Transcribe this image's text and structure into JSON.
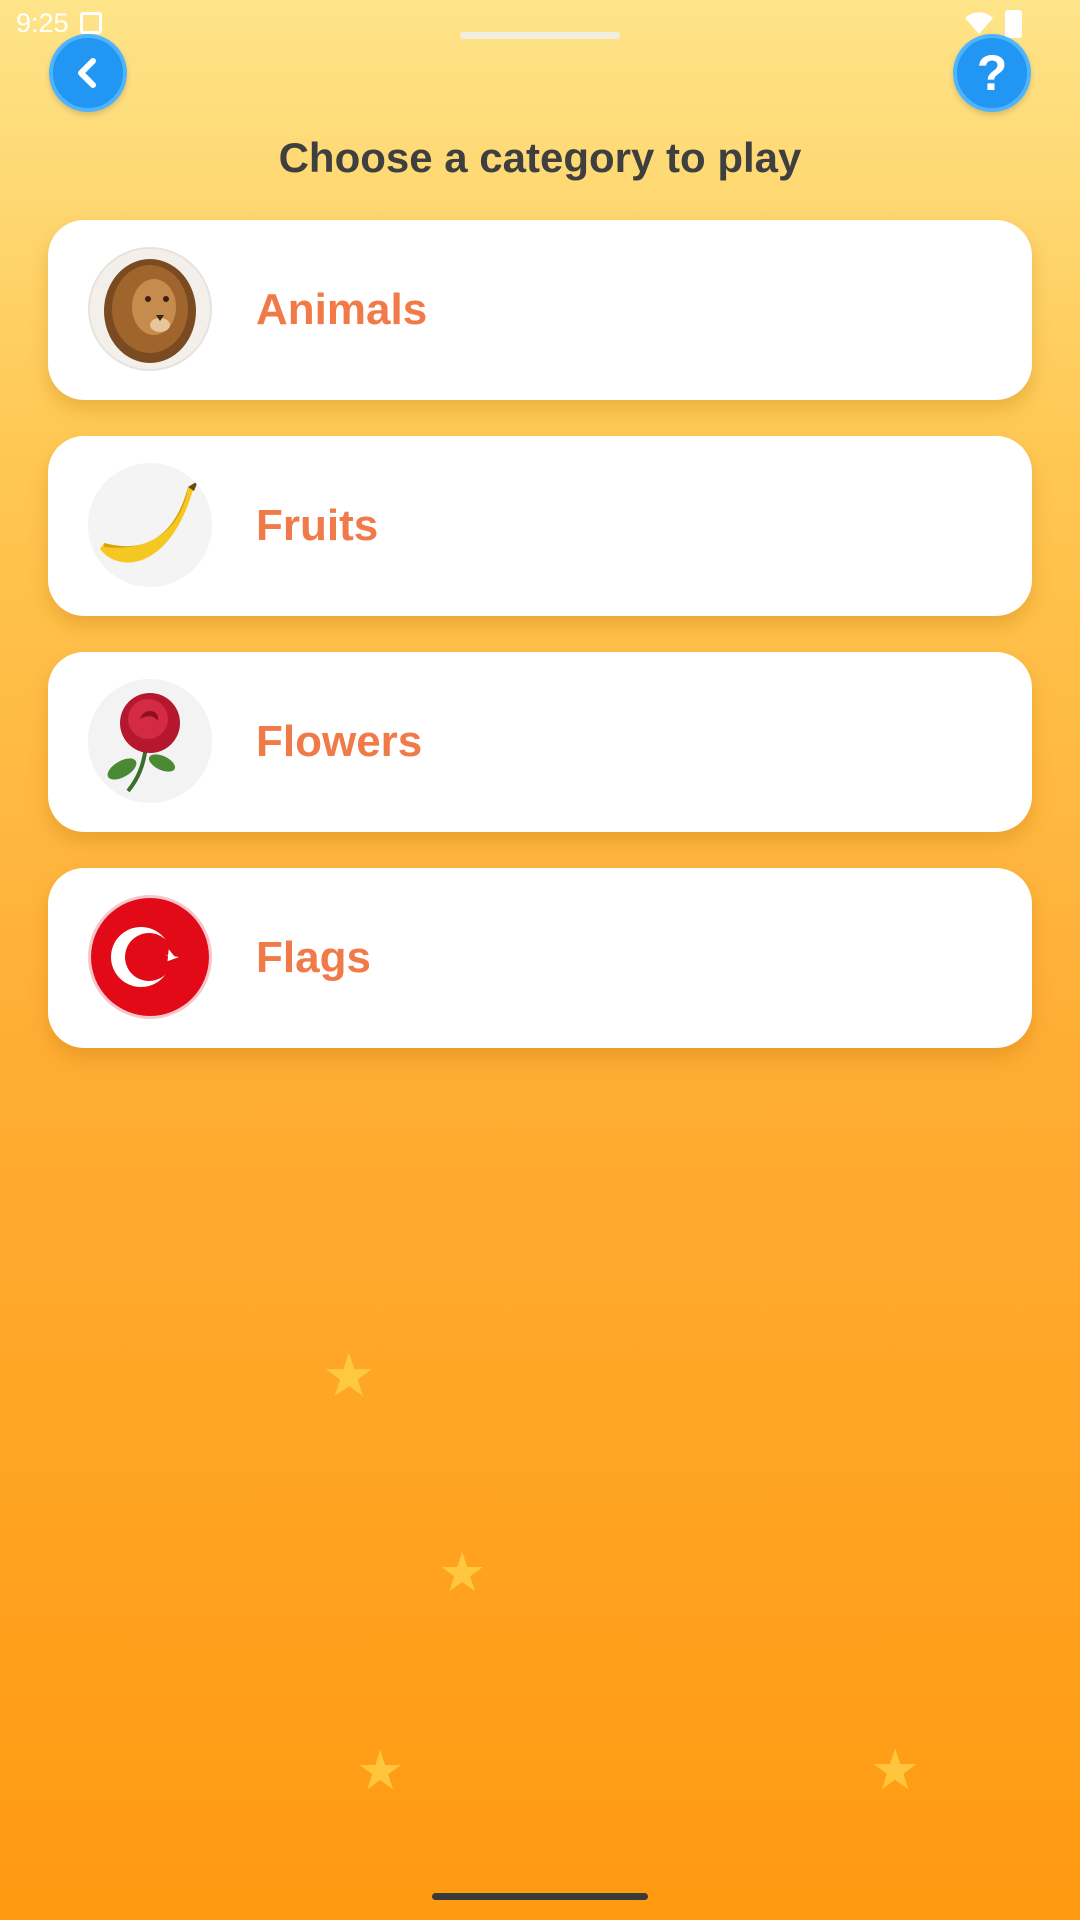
{
  "status_bar": {
    "time": "9:25"
  },
  "header": {
    "title": "Choose a category to play",
    "back_icon": "chevron-left-icon",
    "help_label": "?"
  },
  "categories": [
    {
      "label": "Animals",
      "image": "lion"
    },
    {
      "label": "Fruits",
      "image": "banana"
    },
    {
      "label": "Flowers",
      "image": "rose"
    },
    {
      "label": "Flags",
      "image": "turkey-flag"
    }
  ],
  "colors": {
    "accent": "#2196f3",
    "label": "#f07a48",
    "title": "#3f3f3f",
    "background_top": "#fee489",
    "background_bottom": "#ff9a10"
  }
}
